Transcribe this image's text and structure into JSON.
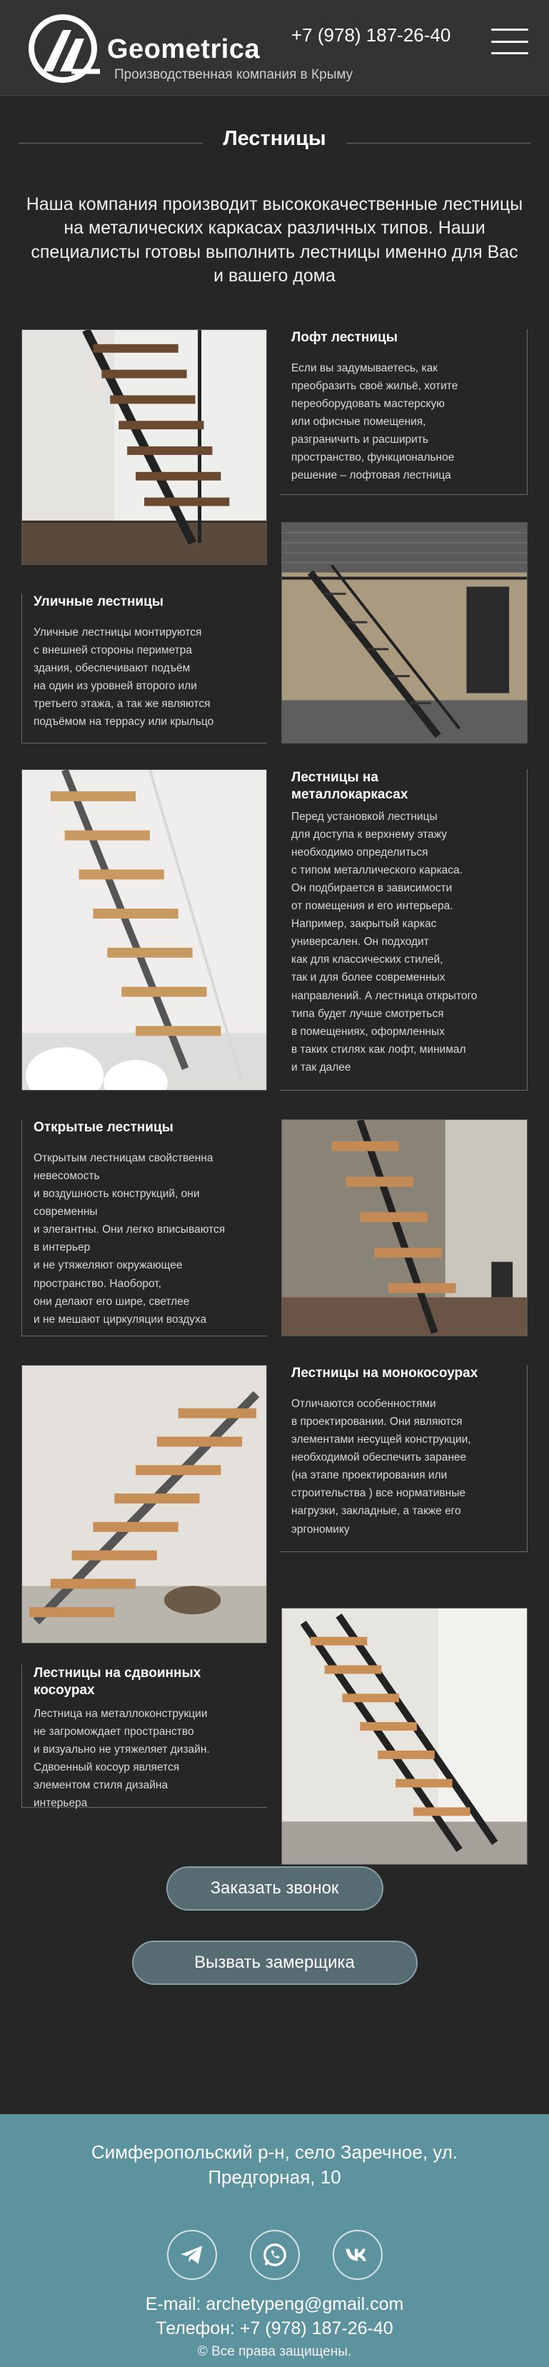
{
  "header": {
    "brand": "Geometrica",
    "subtitle": "Производственная компания в Крыму",
    "phone": "+7 (978) 187-26-40",
    "menu_icon": "hamburger-menu-icon"
  },
  "page": {
    "title": "Лестницы",
    "intro": "Наша компания производит высококачественные лестницы на металических каркасах различных типов. Наши специалисты готовы выполнить лестницы именно для Вас и вашего дома"
  },
  "cards": [
    {
      "title": "Лофт лестницы",
      "text": "Если вы задумываетесь, как\nпреобразить своё жильё, хотите\nпереоборудовать мастерскую\nили офисные помещения,\nразграничить и расширить\nпространство, функциональное\nрешение – лофтовая лестница"
    },
    {
      "title": "Уличные лестницы",
      "text": "Уличные лестницы монтируются\nс внешней стороны периметра\nздания, обеспечивают подъём\nна один из уровней второго или\nтретьего этажа, а так же являются\nподъёмом на террасу или крыльцо"
    },
    {
      "title": "Лестницы на\nметаллокаркасах",
      "text": "Перед установкой лестницы\nдля доступа к верхнему этажу\nнеобходимо определиться\nс типом металлического каркаса.\nОн подбирается в зависимости\nот помещения и его интерьера.\nНапример, закрытый каркас\nуниверсален. Он подходит\nкак для классических стилей,\nтак и для более современных\nнаправлений. А лестница открытого\nтипа будет лучше смотреться\nв помещениях, оформленных\nв таких стилях как лофт, минимал\nи так далее"
    },
    {
      "title": "Открытые лестницы",
      "text": "Открытым лестницам свойственна\nневесомость\nи воздушность конструкций, они\nсовременны\nи элегантны. Они легко вписываются\nв интерьер\nи не утяжеляют окружающее\nпространство. Наоборот,\nони делают его шире, светлее\nи не мешают циркуляции воздуха"
    },
    {
      "title": "Лестницы на монокосоурах",
      "text": "Отличаются особенностями\nв проектировании. Они являются\nэлементами несущей конструкции,\nнеобходимой обеспечить заранее\n(на этапе проектирования или\nстроительства ) все нормативные\nнагрузки, закладные, а также его\nэргономику"
    },
    {
      "title": "Лестницы на сдвоинных\nкосоурах",
      "text": "Лестница на металлоконструкции\nне загромождает пространство\nи визуально не утяжеляет дизайн.\nСдвоенный косоур является\nэлементом стиля дизайна\nинтерьера"
    }
  ],
  "buttons": {
    "call": "Заказать звонок",
    "measure": "Вызвать замерщика"
  },
  "footer": {
    "address": "Симферопольский р-н, село Заречное, ул. Предгорная, 10",
    "email": "E-mail: archetypeng@gmail.com",
    "phone": "Телефон: +7 (978) 187-26-40",
    "copyright": "© Все права защищены.",
    "socials": [
      "telegram-icon",
      "whatsapp-icon",
      "vk-icon"
    ]
  },
  "colors": {
    "background": "#262626",
    "header": "#333333",
    "button": "#566c72",
    "footer": "#5d939f"
  }
}
